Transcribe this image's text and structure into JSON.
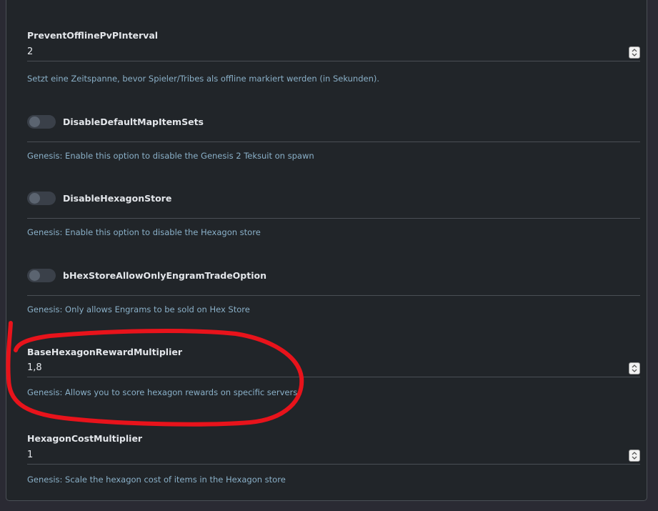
{
  "settings": [
    {
      "type": "number",
      "label": "PreventOfflinePvPInterval",
      "value": "2",
      "help": "Setzt eine Zeitspanne, bevor Spieler/Tribes als offline markiert werden (in Sekunden)."
    },
    {
      "type": "toggle",
      "label": "DisableDefaultMapItemSets",
      "enabled": false,
      "help": "Genesis: Enable this option to disable the Genesis 2 Teksuit on spawn"
    },
    {
      "type": "toggle",
      "label": "DisableHexagonStore",
      "enabled": false,
      "help": "Genesis: Enable this option to disable the Hexagon store"
    },
    {
      "type": "toggle",
      "label": "bHexStoreAllowOnlyEngramTradeOption",
      "enabled": false,
      "help": "Genesis: Only allows Engrams to be sold on Hex Store"
    },
    {
      "type": "number",
      "label": "BaseHexagonRewardMultiplier",
      "value": "1,8",
      "help": "Genesis: Allows you to score hexagon rewards on specific servers"
    },
    {
      "type": "number",
      "label": "HexagonCostMultiplier",
      "value": "1",
      "help": "Genesis: Scale the hexagon cost of items in the Hexagon store"
    }
  ],
  "colors": {
    "panel_bg": "#212529",
    "label_text": "#e3e6ea",
    "help_text": "#8ab0c8",
    "annotation": "#e8131b"
  },
  "icons": {
    "spinner": "up-down-arrows-icon"
  }
}
